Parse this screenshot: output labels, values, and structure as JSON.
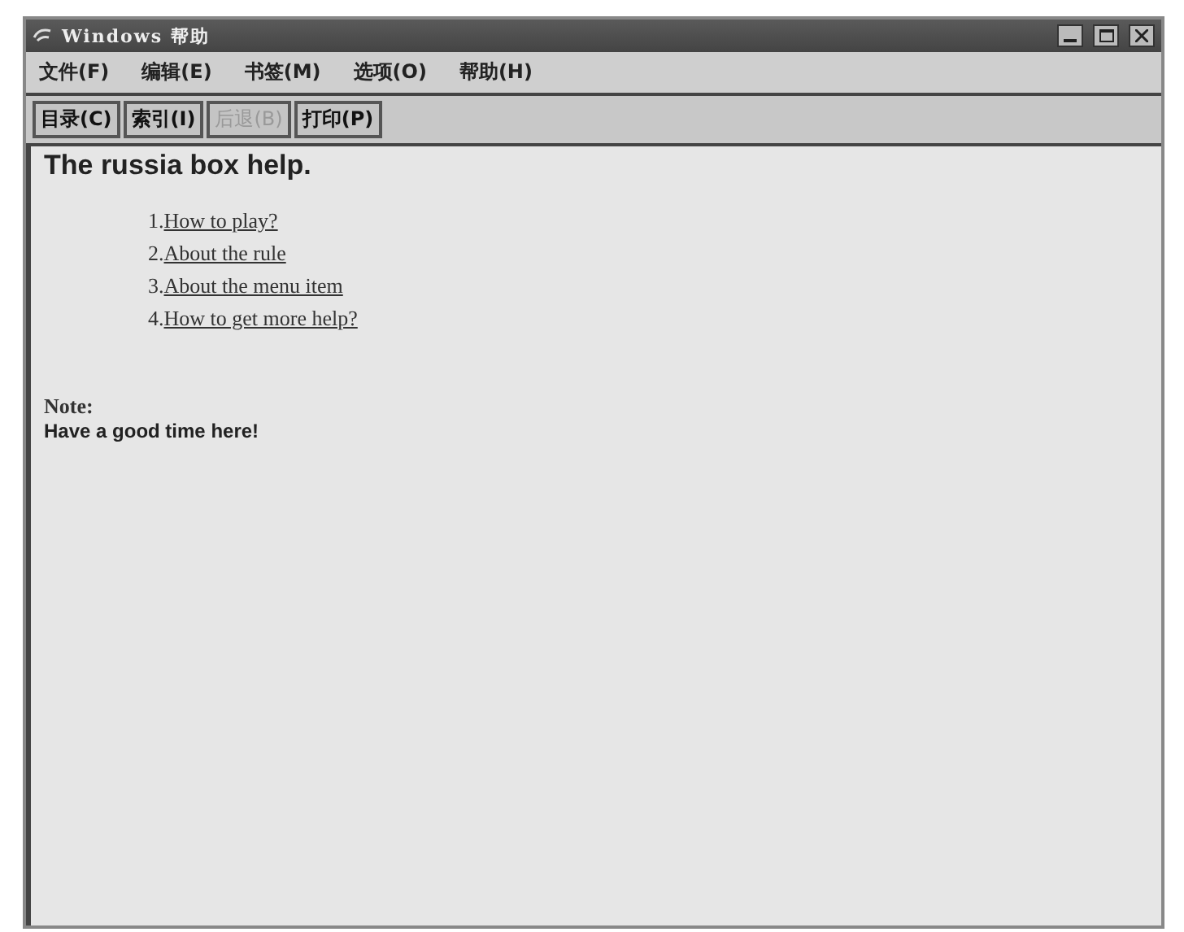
{
  "window": {
    "title": "Windows 帮助"
  },
  "menu": [
    "文件(F)",
    "编辑(E)",
    "书签(M)",
    "选项(O)",
    "帮助(H)"
  ],
  "buttons": [
    {
      "label": "目录(C)",
      "disabled": false
    },
    {
      "label": "索引(I)",
      "disabled": false
    },
    {
      "label": "后退(B)",
      "disabled": true
    },
    {
      "label": "打印(P)",
      "disabled": false
    }
  ],
  "content": {
    "heading": "The russia box help.",
    "links": [
      {
        "number": "1.",
        "text": "How to play?"
      },
      {
        "number": "2.",
        "text": "About the rule"
      },
      {
        "number": "3.",
        "text": "About the menu item"
      },
      {
        "number": "4.",
        "text": "How to get more help?"
      }
    ],
    "note_label": "Note:",
    "note_text": "Have a good time here!"
  }
}
